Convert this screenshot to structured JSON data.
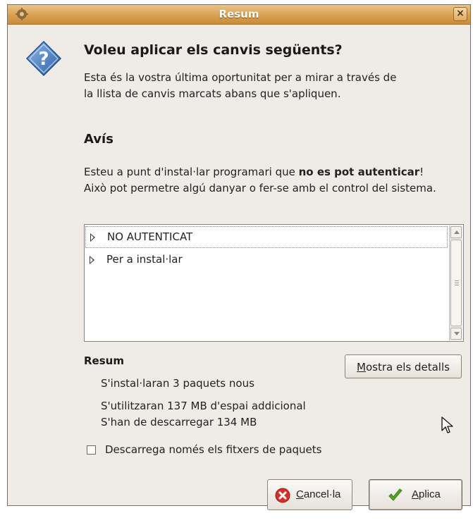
{
  "window": {
    "title": "Resum",
    "close_label": "×"
  },
  "dialog": {
    "heading": "Voleu aplicar els canvis següents?",
    "intro": "Esta és la vostra última oportunitat per a mirar a través de la llista de canvis marcats abans que s'apliquen."
  },
  "warning": {
    "title": "Avís",
    "text_before": "Esteu a punt d'instal·lar programari que ",
    "text_bold": "no es pot autenticar",
    "text_after": "! Això pot permetre algú danyar o fer-se amb el control del sistema."
  },
  "changes_list": {
    "rows": [
      {
        "label": "NO AUTENTICAT"
      },
      {
        "label": "Per a instal·lar"
      }
    ]
  },
  "summary": {
    "title": "Resum",
    "lines": [
      "S'instal·laran 3 paquets nous",
      "S'utilitzaran 137 MB d'espai addicional",
      "S'han de descarregar 134 MB"
    ],
    "details_button": {
      "mnemonic": "M",
      "rest": "ostra els detalls"
    }
  },
  "download_only": {
    "label": "Descarrega només els fitxers de paquets",
    "checked": false
  },
  "buttons": {
    "cancel": {
      "mnemonic": "C",
      "rest": "ancel·la",
      "icon": "cancel-icon"
    },
    "apply": {
      "mnemonic": "A",
      "rest": "plica",
      "icon": "checkmark-icon"
    }
  },
  "colors": {
    "titlebar": "#d9a04f",
    "dialog_bg": "#efebe7",
    "cancel_icon": "#d42f2a",
    "apply_icon": "#5aa526"
  }
}
